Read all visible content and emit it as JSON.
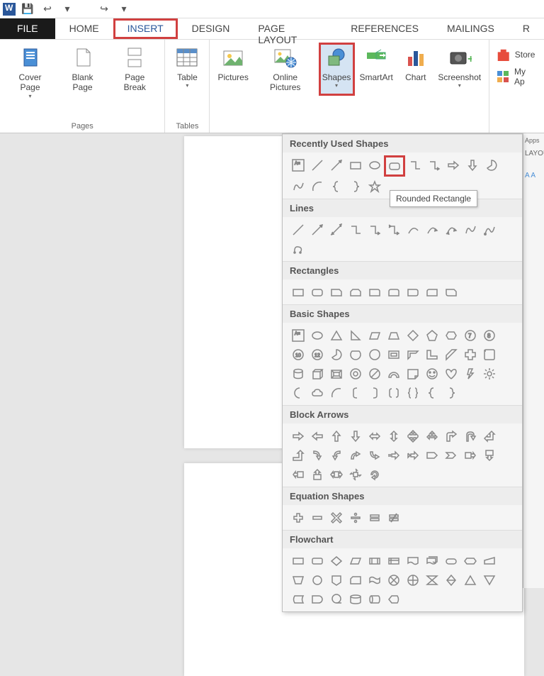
{
  "qat": {
    "save": "💾",
    "undo": "↩",
    "redo": "↪"
  },
  "tabs": {
    "file": "FILE",
    "home": "HOME",
    "insert": "INSERT",
    "design": "DESIGN",
    "page_layout": "PAGE LAYOUT",
    "references": "REFERENCES",
    "mailings": "MAILINGS",
    "review": "R"
  },
  "ribbon": {
    "pages": {
      "cover": "Cover Page",
      "blank": "Blank Page",
      "break": "Page Break",
      "label": "Pages"
    },
    "tables": {
      "table": "Table",
      "label": "Tables"
    },
    "illus": {
      "pictures": "Pictures",
      "online": "Online Pictures",
      "shapes": "Shapes",
      "smartart": "SmartArt",
      "chart": "Chart",
      "screenshot": "Screenshot"
    },
    "apps": {
      "store": "Store",
      "myapps": "My Ap",
      "label": "Apps"
    }
  },
  "shapes_panel": {
    "recent": "Recently Used Shapes",
    "lines": "Lines",
    "rects": "Rectangles",
    "basic": "Basic Shapes",
    "arrows": "Block Arrows",
    "equation": "Equation Shapes",
    "flowchart": "Flowchart"
  },
  "tooltip": "Rounded Rectangle",
  "right_strip": {
    "layout": "LAYOU",
    "font": "A A"
  }
}
